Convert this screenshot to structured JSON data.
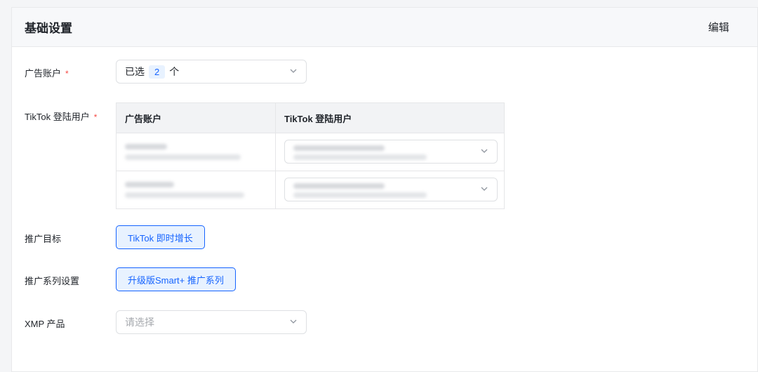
{
  "header": {
    "title": "基础设置",
    "edit_label": "编辑"
  },
  "fields": {
    "ad_account": {
      "label": "广告账户",
      "required_mark": "*",
      "prefix": "已选",
      "count": "2",
      "suffix": "个",
      "icon": "chevron-down-icon"
    },
    "tiktok_user": {
      "label": "TikTok 登陆用户",
      "required_mark": "*",
      "table": {
        "headers": [
          "广告账户",
          "TikTok 登陆用户"
        ],
        "rows": [
          {
            "account": "(blurred)",
            "user": "(blurred)"
          },
          {
            "account": "(blurred)",
            "user": "(blurred)"
          }
        ]
      }
    },
    "promotion_goal": {
      "label": "推广目标",
      "value": "TikTok 即时增长"
    },
    "campaign_setting": {
      "label": "推广系列设置",
      "value": "升级版Smart+ 推广系列"
    },
    "xmp_product": {
      "label": "XMP 产品",
      "placeholder": "请选择",
      "icon": "chevron-down-icon"
    }
  },
  "colors": {
    "accent": "#1664ff",
    "accent_bg": "#e8f2ff",
    "required": "#f54a45"
  }
}
